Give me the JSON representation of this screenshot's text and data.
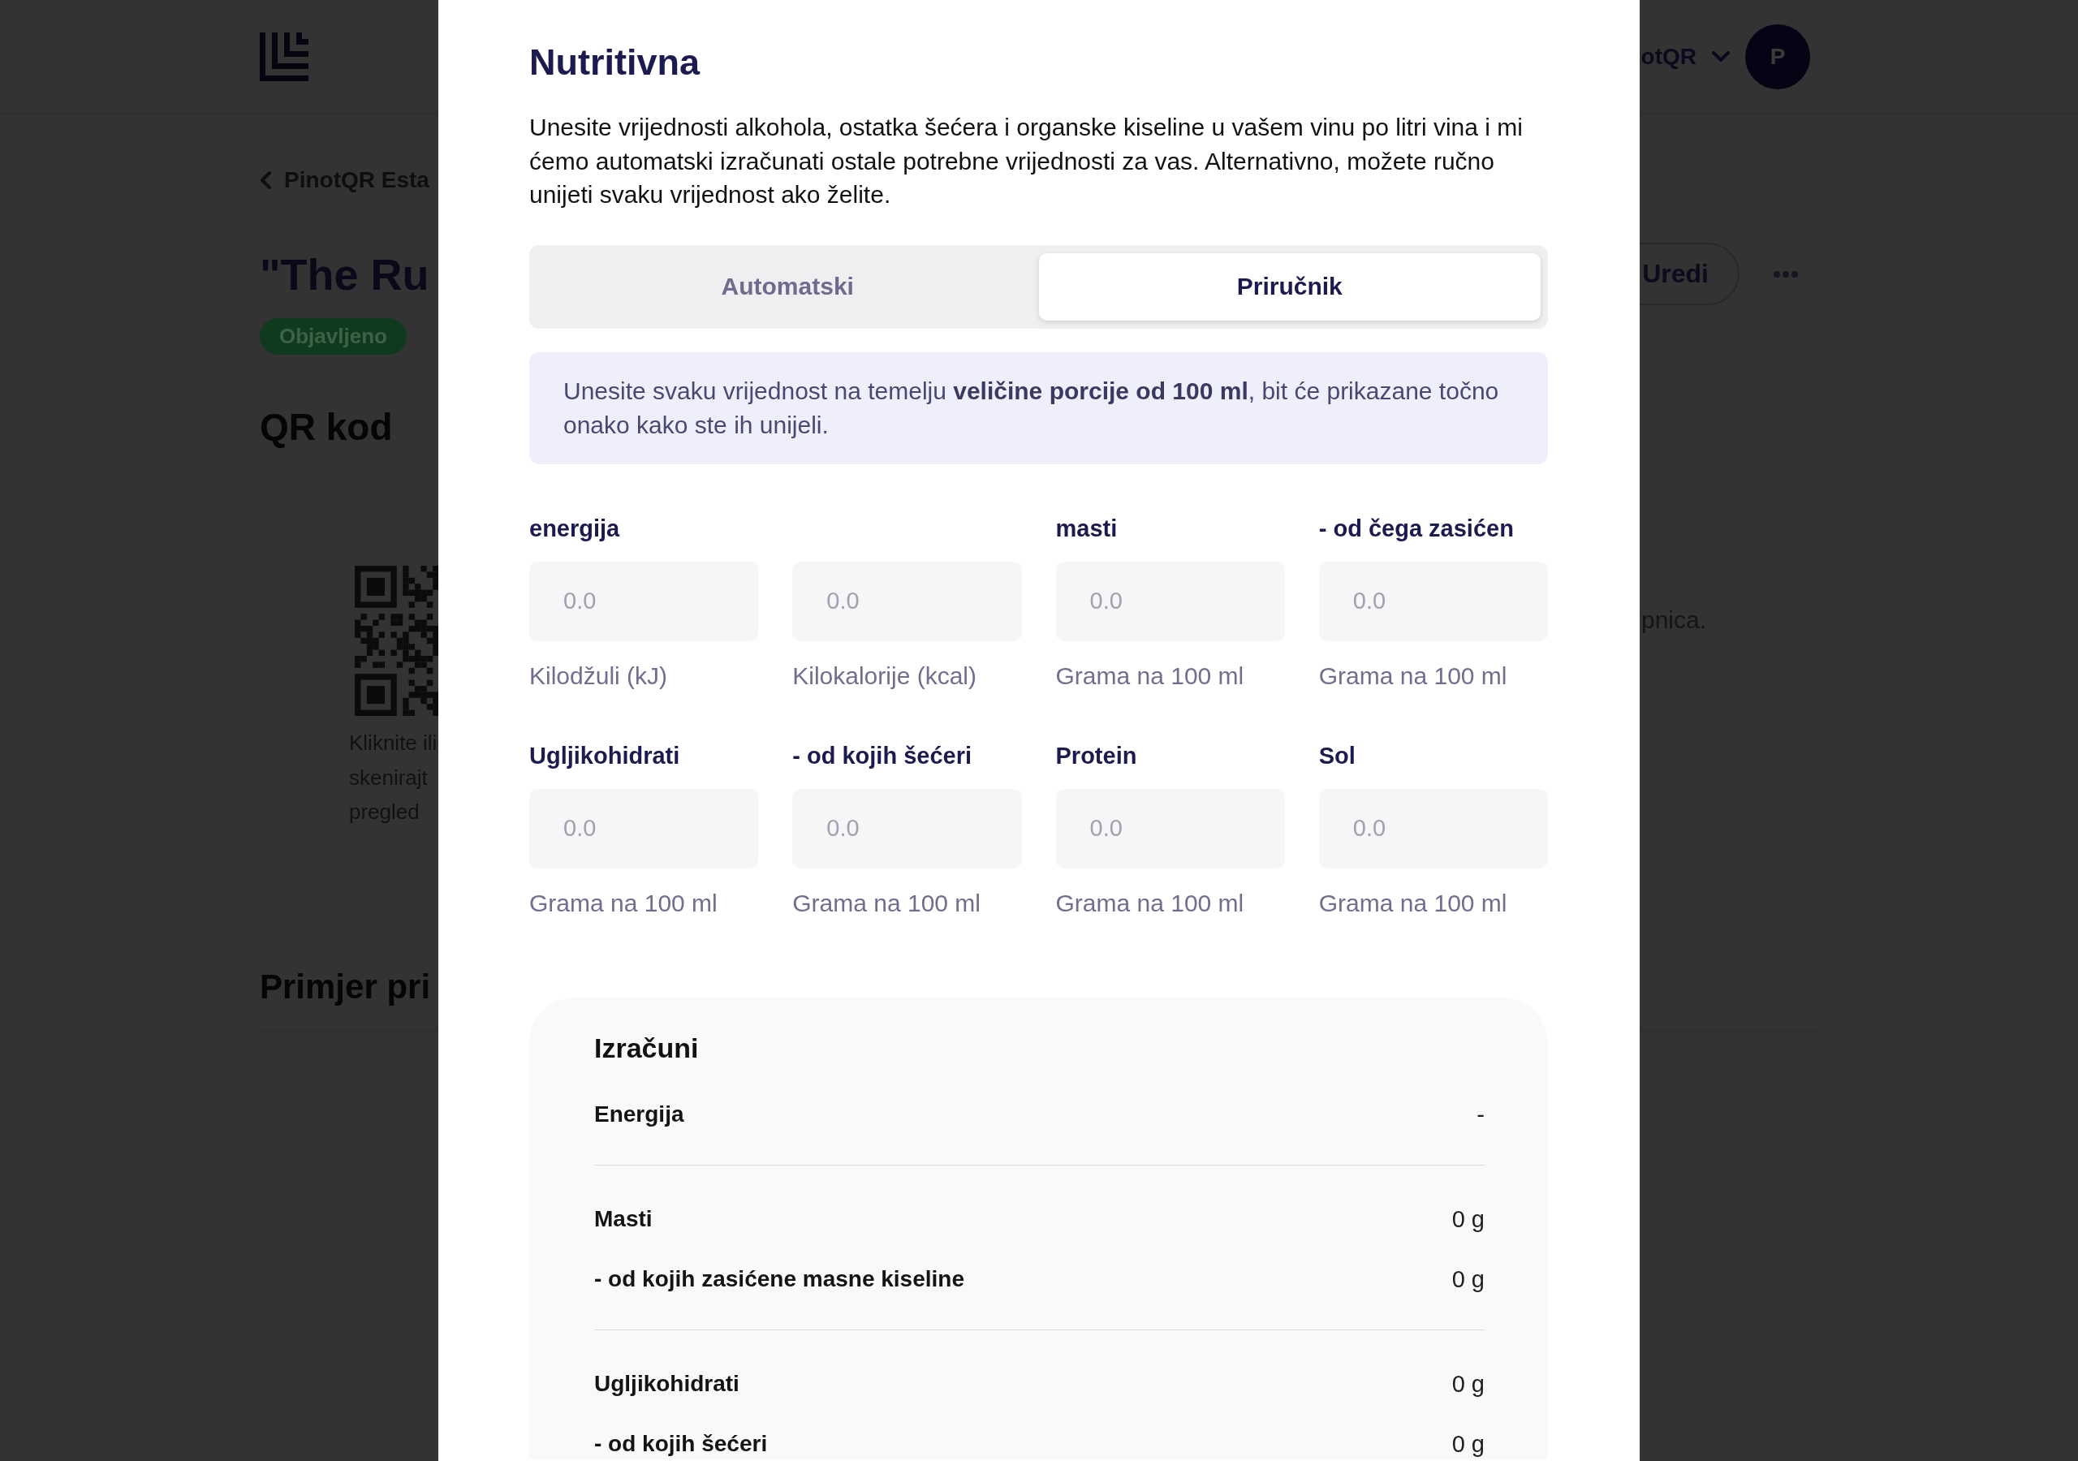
{
  "background_page": {
    "header": {
      "account_name": "otQR",
      "avatar_initial": "P"
    },
    "back_link": "PinotQR Esta",
    "title": "\"The Ru",
    "status_badge": "Objavljeno",
    "edit_button": "Uredi",
    "qr_section": {
      "heading": "QR kod",
      "caption_lines": [
        "Kliknite ili",
        "skenirajt",
        "pregled"
      ],
      "side_text": "pnica."
    },
    "preview_heading": "Primjer pri"
  },
  "modal": {
    "title": "Nutritivna",
    "description": "Unesite vrijednosti alkohola, ostatka šećera i organske kiseline u vašem vinu po litri vina i mi ćemo automatski izračunati ostale potrebne vrijednosti za vas. Alternativno, možete ručno unijeti svaku vrijednost ako želite.",
    "tabs": [
      {
        "label": "Automatski",
        "selected": false
      },
      {
        "label": "Priručnik",
        "selected": true
      }
    ],
    "info": "Unesite svaku vrijednost na temelju **veličine porcije od 100 ml**, bit će prikazane točno onako kako ste ih unijeli.",
    "fields": [
      {
        "label": "energija",
        "placeholder": "0.0",
        "hint": "Kilodžuli (kJ)"
      },
      {
        "placeholder": "0.0",
        "hint": "Kilokalorije (kcal)"
      },
      {
        "label": "masti",
        "placeholder": "0.0",
        "hint": "Grama na 100 ml"
      },
      {
        "label": "- od čega zasićen",
        "placeholder": "0.0",
        "hint": "Grama na 100 ml"
      },
      {
        "label": "Ugljikohidrati",
        "placeholder": "0.0",
        "hint": "Grama na 100 ml"
      },
      {
        "label": "- od kojih šećeri",
        "placeholder": "0.0",
        "hint": "Grama na 100 ml"
      },
      {
        "label": "Protein",
        "placeholder": "0.0",
        "hint": "Grama na 100 ml"
      },
      {
        "label": "Sol",
        "placeholder": "0.0",
        "hint": "Grama na 100 ml"
      }
    ],
    "calculations": {
      "title": "Izračuni",
      "groups": [
        {
          "rows": [
            {
              "label": "Energija",
              "value": "-"
            }
          ]
        },
        {
          "rows": [
            {
              "label": "Masti",
              "value": "0 g"
            },
            {
              "label": "- od kojih zasićene masne kiseline",
              "value": "0 g"
            }
          ]
        },
        {
          "rows": [
            {
              "label": "Ugljikohidrati",
              "value": "0 g"
            },
            {
              "label": "- od kojih šećeri",
              "value": "0 g"
            }
          ]
        }
      ]
    }
  }
}
